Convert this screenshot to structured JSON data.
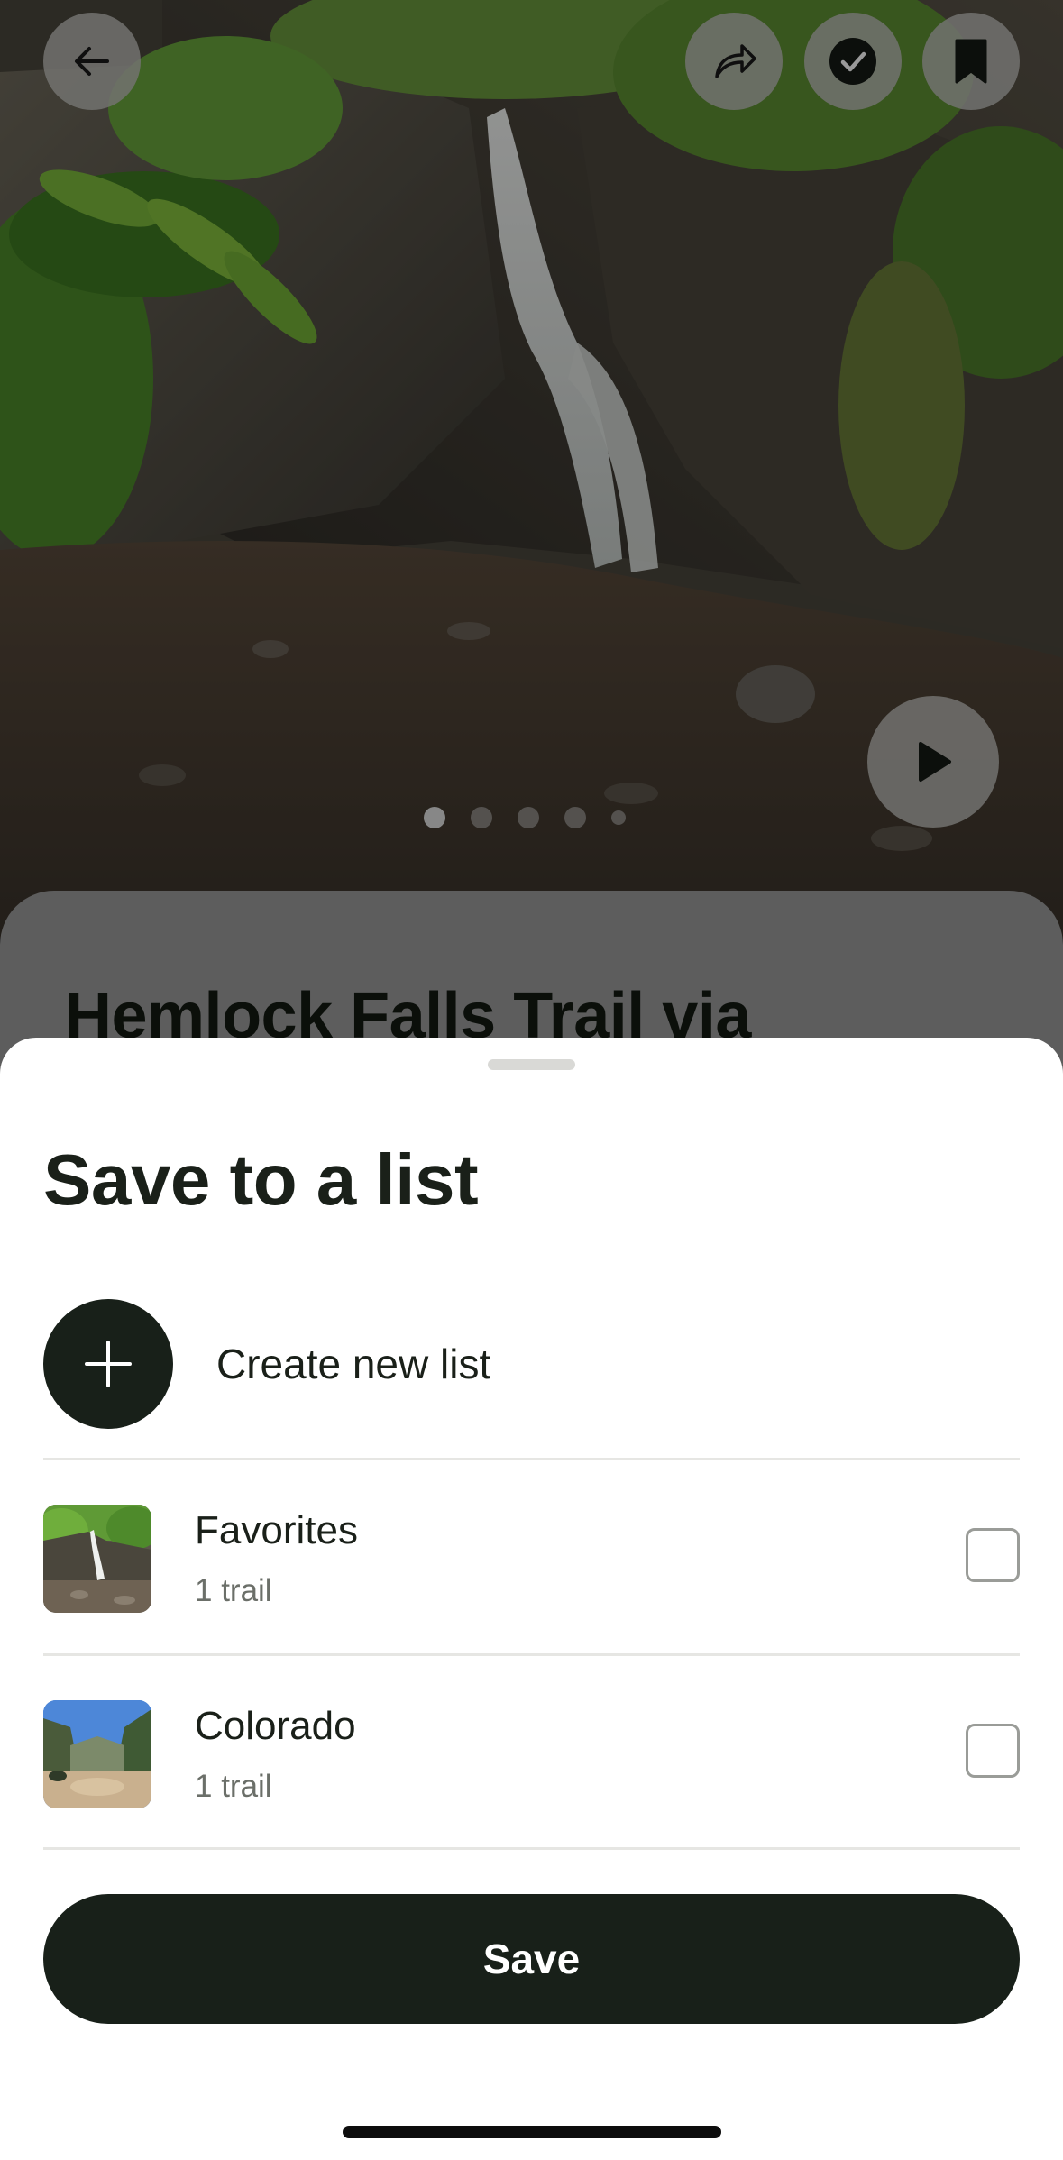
{
  "hero": {
    "carousel_total": 5,
    "carousel_active": 1
  },
  "trail": {
    "title_peek": "Hemlock Falls Trail via"
  },
  "sheet": {
    "title": "Save to a list",
    "create_label": "Create new list",
    "lists": [
      {
        "name": "Favorites",
        "count": "1 trail",
        "checked": false,
        "thumb_icon": "waterfall-photo"
      },
      {
        "name": "Colorado",
        "count": "1 trail",
        "checked": false,
        "thumb_icon": "canyon-photo"
      }
    ],
    "save_label": "Save"
  },
  "icons": {
    "back": "arrow-left-icon",
    "share": "share-icon",
    "complete": "checkmark-icon",
    "bookmark": "bookmark-icon",
    "play": "play-icon",
    "create": "plus-icon"
  },
  "colors": {
    "primary_dark": "#182019",
    "sheet_bg": "#ffffff",
    "divider": "#e6e6e3",
    "muted_text": "#6b6f69"
  }
}
